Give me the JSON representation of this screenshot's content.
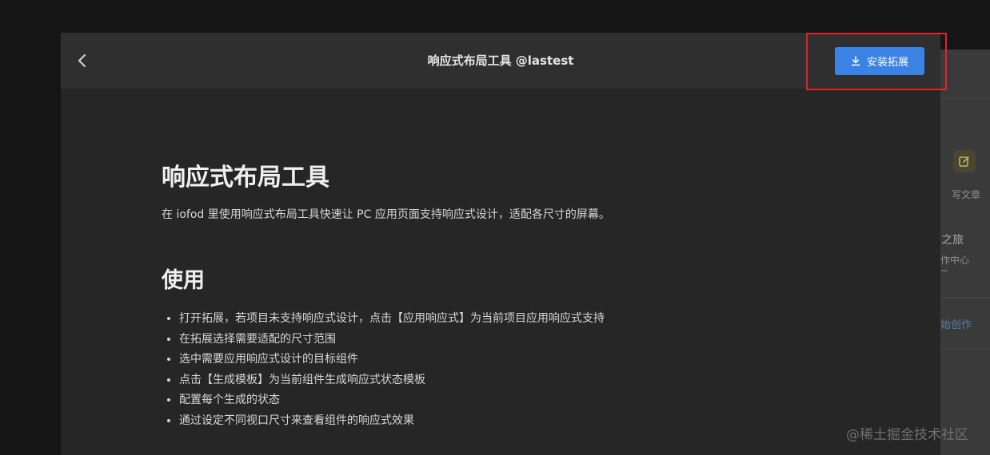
{
  "header": {
    "title": "响应式布局工具 @lastest",
    "install_label": "安装拓展"
  },
  "content": {
    "heading": "响应式布局工具",
    "intro": "在 iofod 里使用响应式布局工具快速让 PC 应用页面支持响应式设计，适配各尺寸的屏幕。",
    "usage_heading": "使用",
    "steps": [
      "打开拓展，若项目未支持响应式设计，点击【应用响应式】为当前项目应用响应式支持",
      "在拓展选择需要适配的尺寸范围",
      "选中需要应用响应式设计的目标组件",
      "点击【生成模板】为当前组件生成响应式状态模板",
      "配置每个生成的状态",
      "通过设定不同视口尺寸来查看组件的响应式效果"
    ]
  },
  "background": {
    "write_article": "写文章",
    "journey": "之旅",
    "creator_center": "作中心",
    "tilde": "~",
    "start_creating": "始创作"
  },
  "watermark": "@稀土掘金技术社区",
  "colors": {
    "accent": "#3a82e4",
    "highlight": "#e0242c"
  }
}
